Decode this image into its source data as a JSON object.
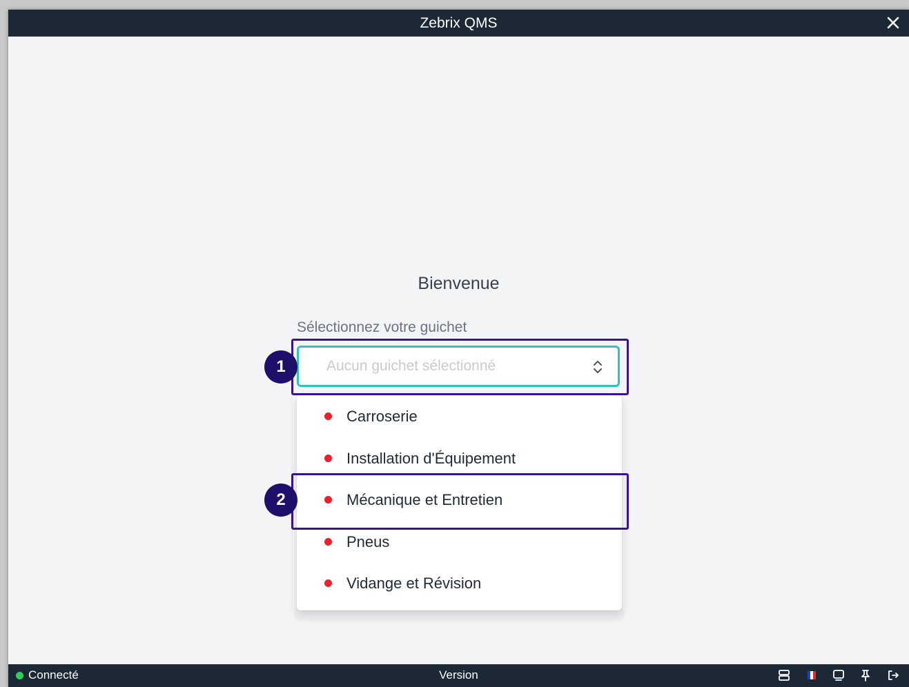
{
  "window": {
    "title": "Zebrix QMS"
  },
  "main": {
    "welcome": "Bienvenue",
    "select_label": "Sélectionnez votre guichet",
    "select_placeholder": "Aucun guichet sélectionné",
    "options": [
      {
        "label": "Carroserie",
        "status_color": "#e8212b"
      },
      {
        "label": "Installation d'Équipement",
        "status_color": "#e8212b"
      },
      {
        "label": "Mécanique et Entretien",
        "status_color": "#e8212b"
      },
      {
        "label": "Pneus",
        "status_color": "#e8212b"
      },
      {
        "label": "Vidange et Révision",
        "status_color": "#e8212b"
      }
    ]
  },
  "annotations": {
    "badge_1": "1",
    "badge_2": "2",
    "color": "#3a1490"
  },
  "statusbar": {
    "status": "Connecté",
    "status_color": "#2bd155",
    "version": "Version",
    "icons": [
      "server-icon",
      "flag-fr-icon",
      "display-icon",
      "pin-icon",
      "logout-icon"
    ]
  },
  "colors": {
    "titlebar": "#1d2836",
    "accent": "#2ec4b6",
    "background": "#f3f4f6"
  }
}
